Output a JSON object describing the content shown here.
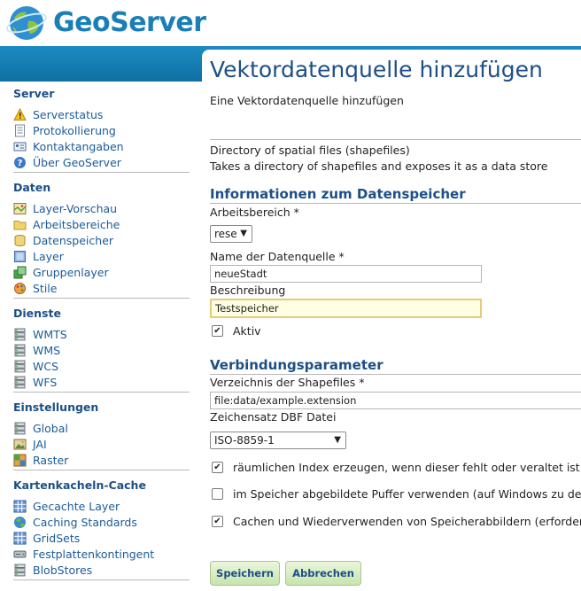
{
  "app": {
    "name": "GeoServer"
  },
  "sidebar": {
    "sections": [
      {
        "title": "Server",
        "items": [
          {
            "label": "Serverstatus",
            "icon": "warning-icon"
          },
          {
            "label": "Protokollierung",
            "icon": "page-icon"
          },
          {
            "label": "Kontaktangaben",
            "icon": "contact-card-icon"
          },
          {
            "label": "Über GeoServer",
            "icon": "help-icon"
          }
        ]
      },
      {
        "title": "Daten",
        "items": [
          {
            "label": "Layer-Vorschau",
            "icon": "map-icon"
          },
          {
            "label": "Arbeitsbereiche",
            "icon": "folder-icon"
          },
          {
            "label": "Datenspeicher",
            "icon": "database-icon"
          },
          {
            "label": "Layer",
            "icon": "layer-icon"
          },
          {
            "label": "Gruppenlayer",
            "icon": "layer-group-icon"
          },
          {
            "label": "Stile",
            "icon": "palette-icon"
          }
        ]
      },
      {
        "title": "Dienste",
        "items": [
          {
            "label": "WMTS",
            "icon": "server-icon"
          },
          {
            "label": "WMS",
            "icon": "server-icon"
          },
          {
            "label": "WCS",
            "icon": "server-icon"
          },
          {
            "label": "WFS",
            "icon": "server-icon"
          }
        ]
      },
      {
        "title": "Einstellungen",
        "items": [
          {
            "label": "Global",
            "icon": "server-icon"
          },
          {
            "label": "JAI",
            "icon": "image-icon"
          },
          {
            "label": "Raster",
            "icon": "raster-icon"
          }
        ]
      },
      {
        "title": "Kartenkacheln-Cache",
        "items": [
          {
            "label": "Gecachte Layer",
            "icon": "grid-icon"
          },
          {
            "label": "Caching Standards",
            "icon": "globe-icon"
          },
          {
            "label": "GridSets",
            "icon": "grid-icon"
          },
          {
            "label": "Festplattenkontingent",
            "icon": "disk-icon"
          },
          {
            "label": "BlobStores",
            "icon": "server-icon"
          }
        ]
      }
    ]
  },
  "page": {
    "title": "Vektordatenquelle hinzufügen",
    "subtitle": "Eine Vektordatenquelle hinzufügen",
    "type_name": "Directory of spatial files (shapefiles)",
    "type_desc": "Takes a directory of shapefiles and exposes it as a data store",
    "section_info": "Informationen zum Datenspeicher",
    "workspace_label": "Arbeitsbereich *",
    "workspace_value": "rese",
    "name_label": "Name der Datenquelle *",
    "name_value": "neueStadt",
    "desc_label": "Beschreibung",
    "desc_value": "Testspeicher",
    "enabled_label": "Aktiv",
    "section_conn": "Verbindungsparameter",
    "dir_label": "Verzeichnis der Shapefiles *",
    "dir_value": "file:data/example.extension",
    "charset_label": "Zeichensatz DBF Datei",
    "charset_value": "ISO-8859-1",
    "opt_index": "räumlichen Index erzeugen, wenn dieser fehlt oder veraltet ist",
    "opt_buffer": "im Speicher abgebildete Puffer verwenden (auf Windows zu deak",
    "opt_cache": "Cachen und Wiederverwenden von Speicherabbildern (erfordert a",
    "save_label": "Speichern",
    "cancel_label": "Abbrechen"
  }
}
